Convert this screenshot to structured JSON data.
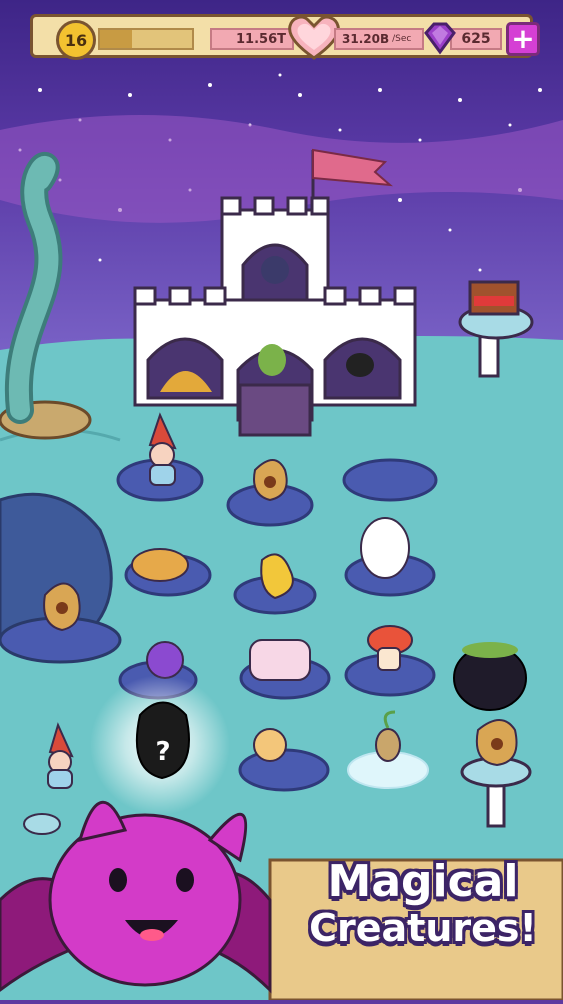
{
  "hud": {
    "level": "16",
    "xp_progress": 0.35,
    "gold": "11.56T",
    "rate_value": "31.20B",
    "rate_unit": "/Sec",
    "gems": "625",
    "add_gems_symbol": "+"
  },
  "promo": {
    "line1": "Magical",
    "line2": "Creatures!"
  },
  "icons": {
    "level": "level-badge",
    "heart": "heart-icon",
    "gem": "gem-icon"
  },
  "colors": {
    "sky_top": "#4a2b8e",
    "sky_mid": "#8d5cc4",
    "ground": "#6ec6c8",
    "platform": "#4a5bb0",
    "hud_bg": "#f3dfa8",
    "pink_box": "#f2a9b2",
    "plus_button": "#d53fd4",
    "bat_purple": "#d33bc8"
  }
}
